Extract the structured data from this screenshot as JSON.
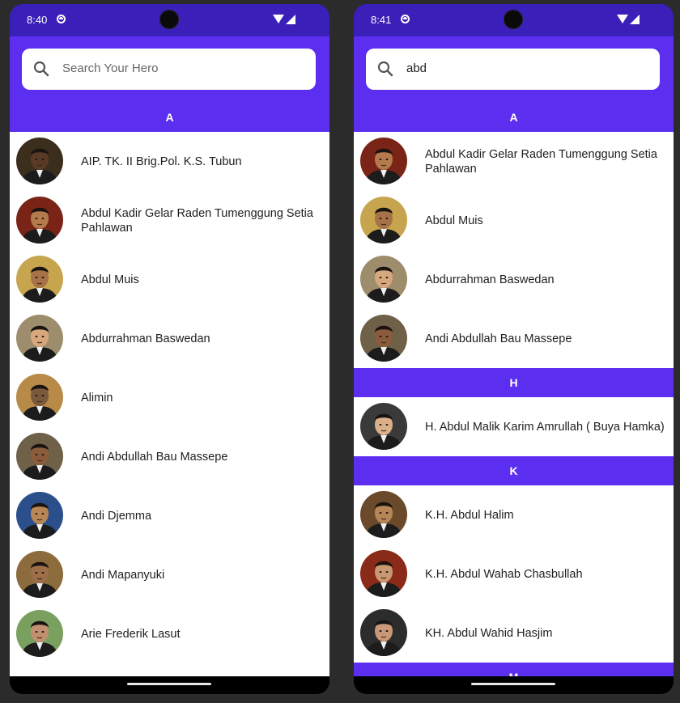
{
  "screens": [
    {
      "status": {
        "time": "8:40"
      },
      "search": {
        "placeholder": "Search Your Hero",
        "value": ""
      },
      "sections": [
        {
          "letter": "A",
          "heroes": [
            {
              "name": "AIP. TK. II Brig.Pol. K.S. Tubun",
              "tone": "#5a3a24",
              "bg": "#3b2e1c"
            },
            {
              "name": "Abdul Kadir Gelar Raden Tumenggung Setia Pahlawan",
              "tone": "#b57a4c",
              "bg": "#7a2418"
            },
            {
              "name": "Abdul Muis",
              "tone": "#a87248",
              "bg": "#c7a54f"
            },
            {
              "name": "Abdurrahman Baswedan",
              "tone": "#d7a77d",
              "bg": "#9d8d6c"
            },
            {
              "name": "Alimin",
              "tone": "#7a5a3b",
              "bg": "#b88a47"
            },
            {
              "name": "Andi Abdullah Bau Massepe",
              "tone": "#8b5c3c",
              "bg": "#6f6048"
            },
            {
              "name": "Andi Djemma",
              "tone": "#b88655",
              "bg": "#2a4f8a"
            },
            {
              "name": "Andi Mapanyuki",
              "tone": "#9c6e4a",
              "bg": "#8c6b3c"
            },
            {
              "name": "Arie Frederik Lasut",
              "tone": "#c09070",
              "bg": "#7aa060"
            }
          ]
        }
      ]
    },
    {
      "status": {
        "time": "8:41"
      },
      "search": {
        "placeholder": "Search Your Hero",
        "value": "abd"
      },
      "sections": [
        {
          "letter": "A",
          "heroes": [
            {
              "name": "Abdul Kadir Gelar Raden Tumenggung Setia Pahlawan",
              "tone": "#b57a4c",
              "bg": "#7a2418"
            },
            {
              "name": "Abdul Muis",
              "tone": "#a87248",
              "bg": "#c7a54f"
            },
            {
              "name": "Abdurrahman Baswedan",
              "tone": "#d7a77d",
              "bg": "#9d8d6c"
            },
            {
              "name": "Andi Abdullah Bau Massepe",
              "tone": "#8b5c3c",
              "bg": "#6f6048"
            }
          ]
        },
        {
          "letter": "H",
          "heroes": [
            {
              "name": "H. Abdul Malik Karim Amrullah ( Buya Hamka)",
              "tone": "#d9b08a",
              "bg": "#3a3a3a"
            }
          ]
        },
        {
          "letter": "K",
          "heroes": [
            {
              "name": "K.H. Abdul Halim",
              "tone": "#b58758",
              "bg": "#6a4a2a"
            },
            {
              "name": "K.H. Abdul Wahab Chasbullah",
              "tone": "#c99770",
              "bg": "#8a2a18"
            },
            {
              "name": "KH. Abdul Wahid Hasjim",
              "tone": "#c89878",
              "bg": "#2c2c2c"
            }
          ]
        },
        {
          "letter": "M",
          "heroes": []
        }
      ]
    }
  ]
}
